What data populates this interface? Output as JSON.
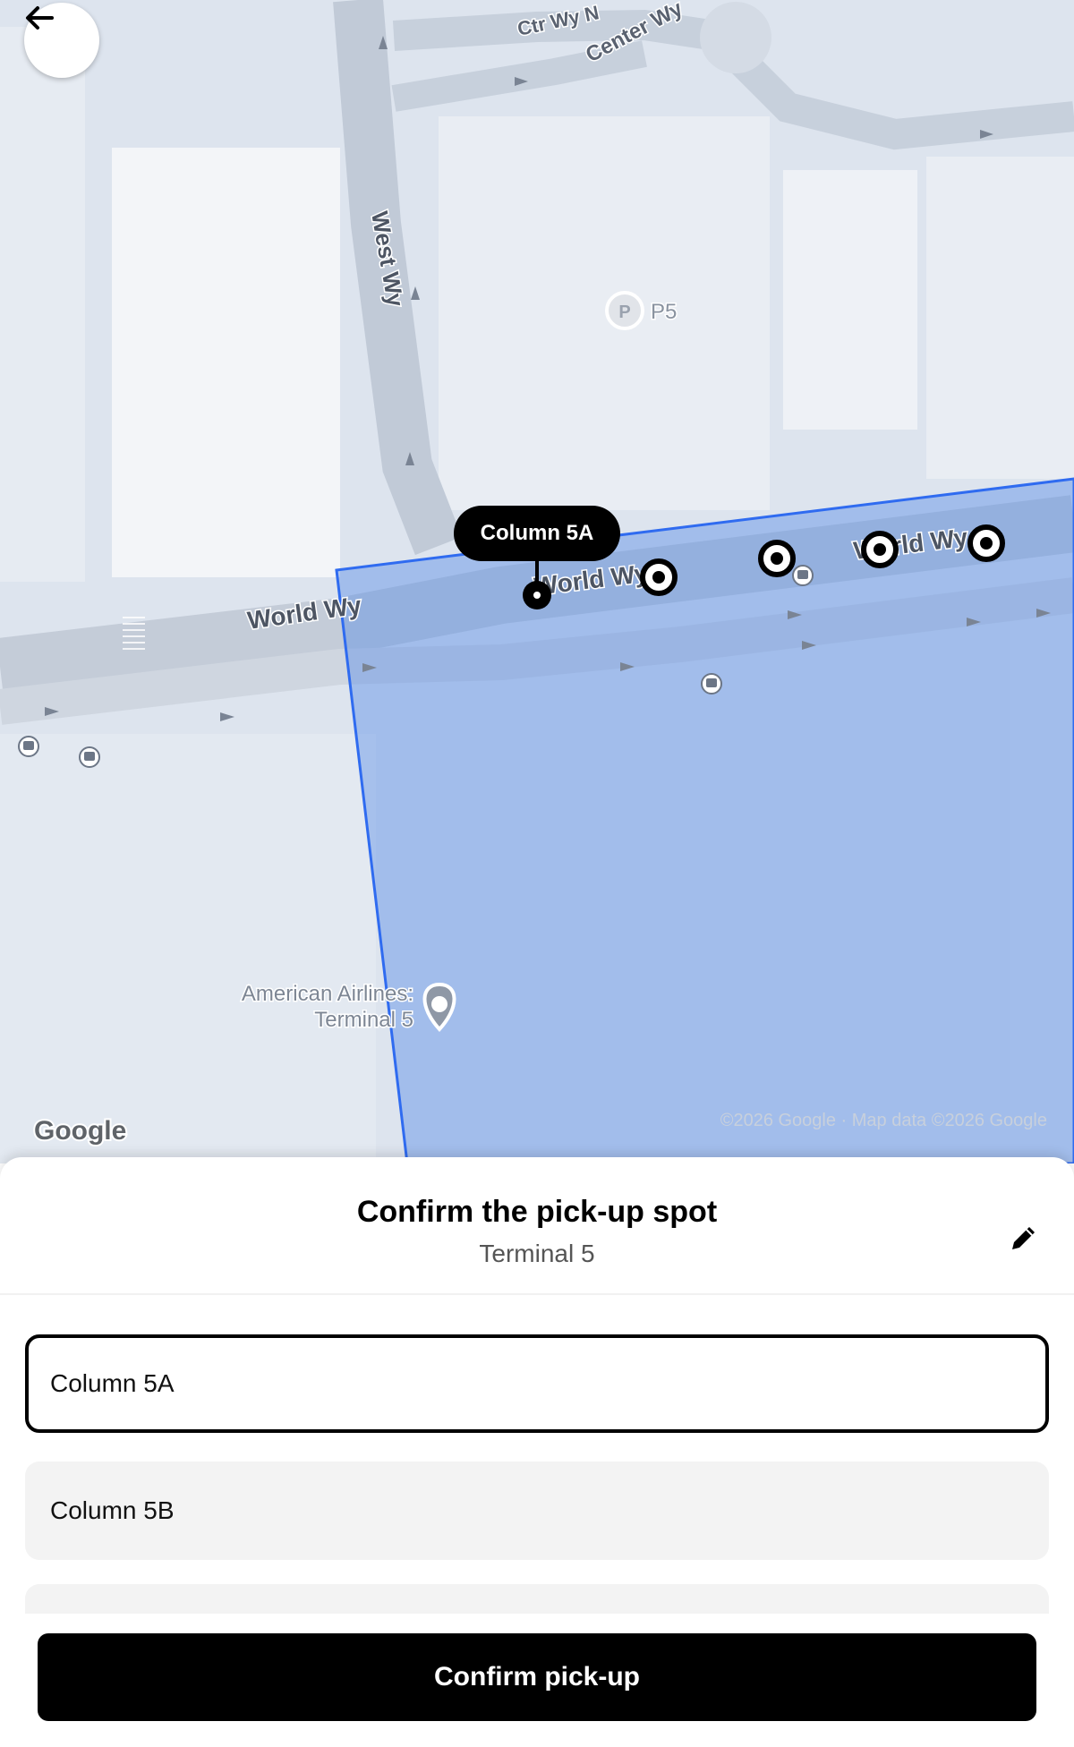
{
  "map": {
    "streets": {
      "ctr_wy_n": "Ctr Wy N",
      "center_wy": "Center Wy",
      "west_wy": "West Wy",
      "world_wy_left": "World Wy",
      "world_wy_mid": "World Wy",
      "world_wy_right": "World Wy"
    },
    "parking_badge": "P",
    "parking_label": "P5",
    "poi_name_line1": "American Airlines:",
    "poi_name_line2": "Terminal 5",
    "google_logo": "Google",
    "attribution": "©2026 Google · Map data ©2026 Google",
    "selected_spot_callout": "Column 5A",
    "zone_color": "#5b8de6",
    "zone_border_color": "#2f6bf0"
  },
  "back_icon": "arrow-left-icon",
  "sheet": {
    "title": "Confirm the pick-up spot",
    "subtitle": "Terminal 5",
    "edit_icon": "pencil-icon",
    "options": [
      {
        "label": "Column 5A",
        "selected": true
      },
      {
        "label": "Column 5B",
        "selected": false
      },
      {
        "label": "",
        "selected": false
      }
    ]
  },
  "footer": {
    "confirm_label": "Confirm pick-up"
  }
}
